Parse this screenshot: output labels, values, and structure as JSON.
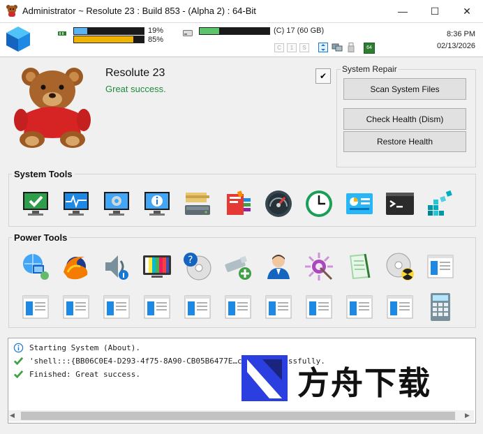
{
  "window": {
    "title": "Administrator ~ Resolute 23 : Build 853 - (Alpha 2) : 64-Bit",
    "minimize_label": "—",
    "maximize_label": "☐",
    "close_label": "✕"
  },
  "header": {
    "cpu_percent_label": "19%",
    "cpu_value": 0.19,
    "ram_percent_label": "85%",
    "ram_value": 0.85,
    "disk_label": "(C) 17 (60 GB)",
    "disk_value": 0.28,
    "indicators": [
      "C",
      "1",
      "S"
    ],
    "badge_64": "64",
    "time": "8:36 PM",
    "date": "02/13/2026",
    "colors": {
      "cpu": "#5ab4f0",
      "ram": "#f0b400",
      "disk": "#5cc46a"
    }
  },
  "main": {
    "app_name": "Resolute 23",
    "status": "Great success.",
    "checkbox_mark": "✔"
  },
  "system_repair": {
    "title": "System Repair",
    "scan_label": "Scan System Files",
    "check_label": "Check Health (Dism)",
    "restore_label": "Restore Health"
  },
  "system_tools": {
    "title": "System Tools",
    "icons": [
      "security-check-icon",
      "performance-monitor-icon",
      "system-settings-icon",
      "system-info-icon",
      "disk-drive-icon",
      "office-apps-icon",
      "speedometer-icon",
      "clock-icon",
      "dashboard-icon",
      "command-prompt-icon",
      "registry-blocks-icon"
    ]
  },
  "power_tools": {
    "title": "Power Tools",
    "icons": [
      "network-globe-icon",
      "firefox-globe-icon",
      "sound-volume-icon",
      "color-tv-icon",
      "help-disc-icon",
      "add-usb-icon",
      "user-account-icon",
      "magic-sun-icon",
      "notepad-icon",
      "burn-disc-icon",
      "window-app-icon",
      "window-app-icon",
      "window-app-icon",
      "window-app-icon",
      "window-app-icon",
      "window-app-icon",
      "window-app-icon",
      "window-app-icon",
      "window-app-icon",
      "window-app-icon",
      "window-app-icon",
      "calculator-icon"
    ]
  },
  "log": {
    "lines": [
      {
        "icon": "info",
        "text": "Starting System (About)."
      },
      {
        "icon": "check",
        "text": "'shell:::{BB06C0E4-D293-4f75-8A90-CB05B6477E…cuted successfully."
      },
      {
        "icon": "check",
        "text": "Finished: Great success."
      }
    ]
  },
  "watermark": {
    "text": "方舟下载"
  }
}
